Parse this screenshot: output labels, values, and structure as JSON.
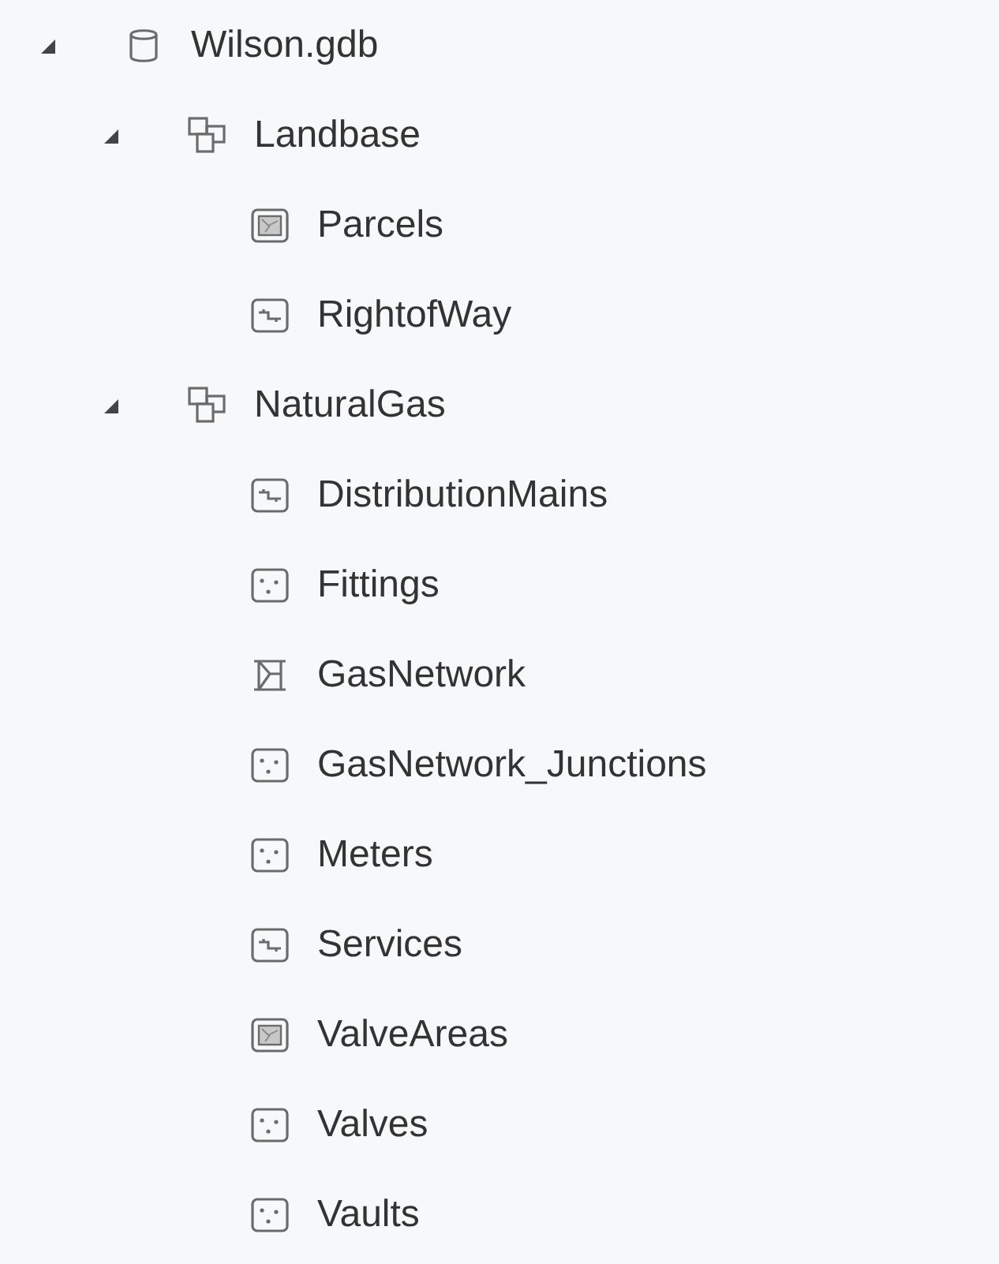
{
  "tree": [
    {
      "label": "Wilson.gdb",
      "kind": "database",
      "expanded": true,
      "children": [
        {
          "label": "Landbase",
          "kind": "dataset",
          "expanded": true,
          "children": [
            {
              "label": "Parcels",
              "kind": "polygon"
            },
            {
              "label": "RightofWay",
              "kind": "line"
            }
          ]
        },
        {
          "label": "NaturalGas",
          "kind": "dataset",
          "expanded": true,
          "children": [
            {
              "label": "DistributionMains",
              "kind": "line"
            },
            {
              "label": "Fittings",
              "kind": "point"
            },
            {
              "label": "GasNetwork",
              "kind": "network"
            },
            {
              "label": "GasNetwork_Junctions",
              "kind": "point"
            },
            {
              "label": "Meters",
              "kind": "point"
            },
            {
              "label": "Services",
              "kind": "line"
            },
            {
              "label": "ValveAreas",
              "kind": "polygon"
            },
            {
              "label": "Valves",
              "kind": "point"
            },
            {
              "label": "Vaults",
              "kind": "point"
            }
          ]
        }
      ]
    }
  ]
}
